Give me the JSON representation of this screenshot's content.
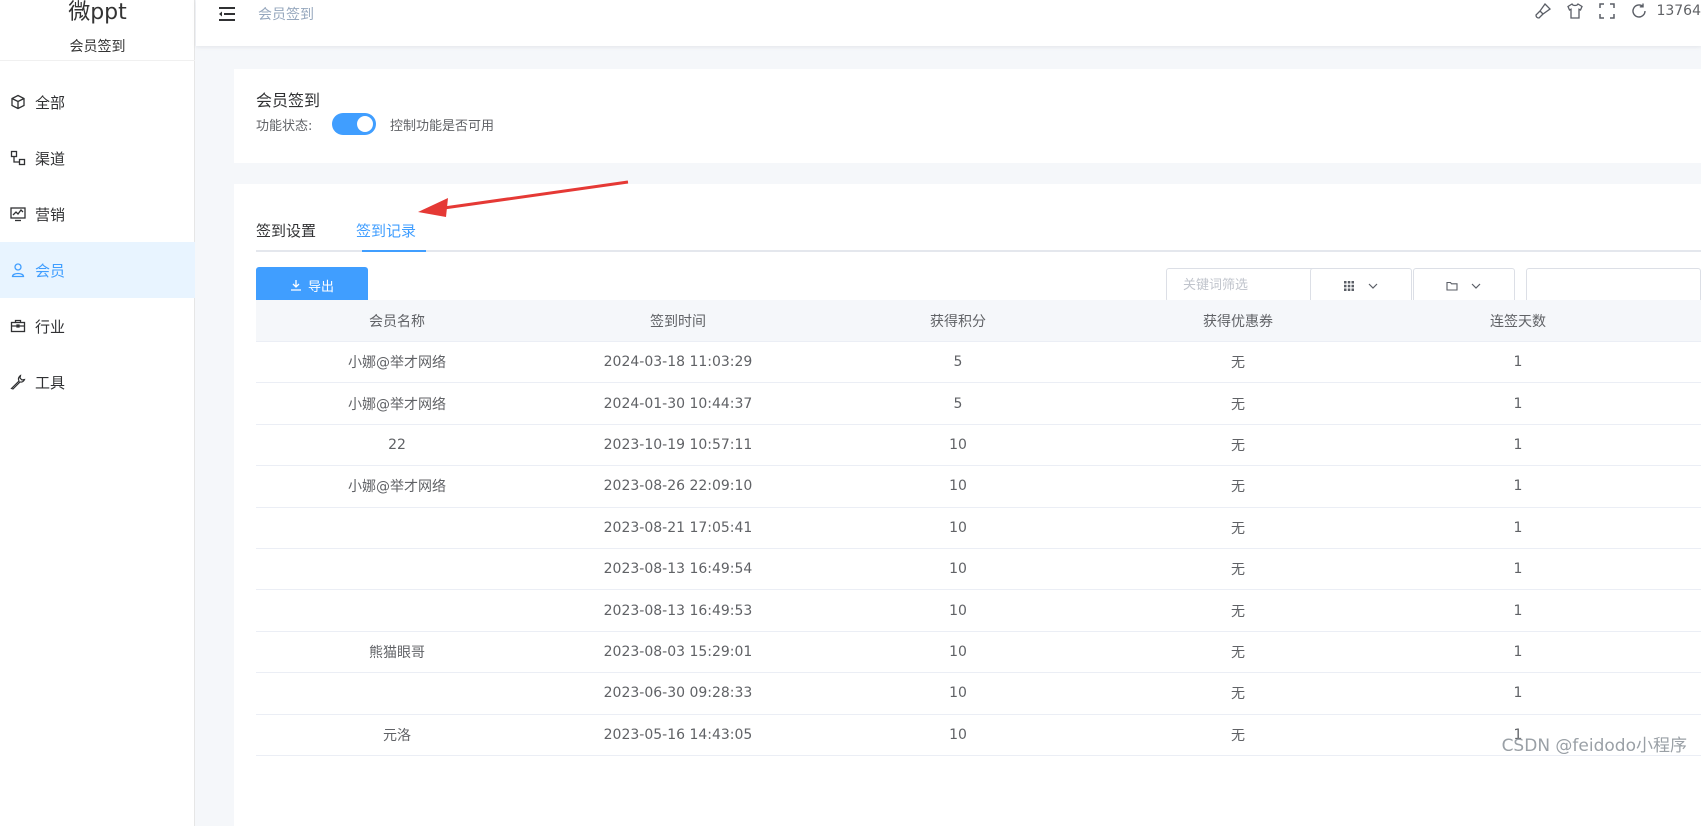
{
  "sidebar": {
    "app_title": "微ppt",
    "app_subtitle": "会员签到",
    "items": [
      {
        "label": "全部",
        "icon": "cube-icon"
      },
      {
        "label": "渠道",
        "icon": "channel-icon"
      },
      {
        "label": "营销",
        "icon": "marketing-icon"
      },
      {
        "label": "会员",
        "icon": "user-icon"
      },
      {
        "label": "行业",
        "icon": "briefcase-icon"
      },
      {
        "label": "工具",
        "icon": "wrench-icon"
      }
    ],
    "active_index": 3
  },
  "header": {
    "breadcrumb": "会员签到",
    "user": "13764"
  },
  "feature": {
    "title": "会员签到",
    "status_label": "功能状态:",
    "status_on": true,
    "status_desc": "控制功能是否可用"
  },
  "tabs": [
    {
      "label": "签到设置"
    },
    {
      "label": "签到记录"
    }
  ],
  "active_tab": 1,
  "toolbar": {
    "export_label": "导出",
    "search_placeholder": "关键词筛选"
  },
  "table": {
    "columns": [
      "会员名称",
      "签到时间",
      "获得积分",
      "获得优惠券",
      "连签天数"
    ],
    "rows": [
      [
        "小娜@举才网络",
        "2024-03-18 11:03:29",
        "5",
        "无",
        "1"
      ],
      [
        "小娜@举才网络",
        "2024-01-30 10:44:37",
        "5",
        "无",
        "1"
      ],
      [
        "22",
        "2023-10-19 10:57:11",
        "10",
        "无",
        "1"
      ],
      [
        "小娜@举才网络",
        "2023-08-26 22:09:10",
        "10",
        "无",
        "1"
      ],
      [
        "",
        "2023-08-21 17:05:41",
        "10",
        "无",
        "1"
      ],
      [
        "",
        "2023-08-13 16:49:54",
        "10",
        "无",
        "1"
      ],
      [
        "",
        "2023-08-13 16:49:53",
        "10",
        "无",
        "1"
      ],
      [
        "熊猫眼哥",
        "2023-08-03 15:29:01",
        "10",
        "无",
        "1"
      ],
      [
        "",
        "2023-06-30 09:28:33",
        "10",
        "无",
        "1"
      ],
      [
        "元洛",
        "2023-05-16 14:43:05",
        "10",
        "无",
        "1"
      ]
    ]
  },
  "watermark": "CSDN @feidodo小程序",
  "colors": {
    "accent": "#409eff",
    "arrow": "#e53935"
  }
}
